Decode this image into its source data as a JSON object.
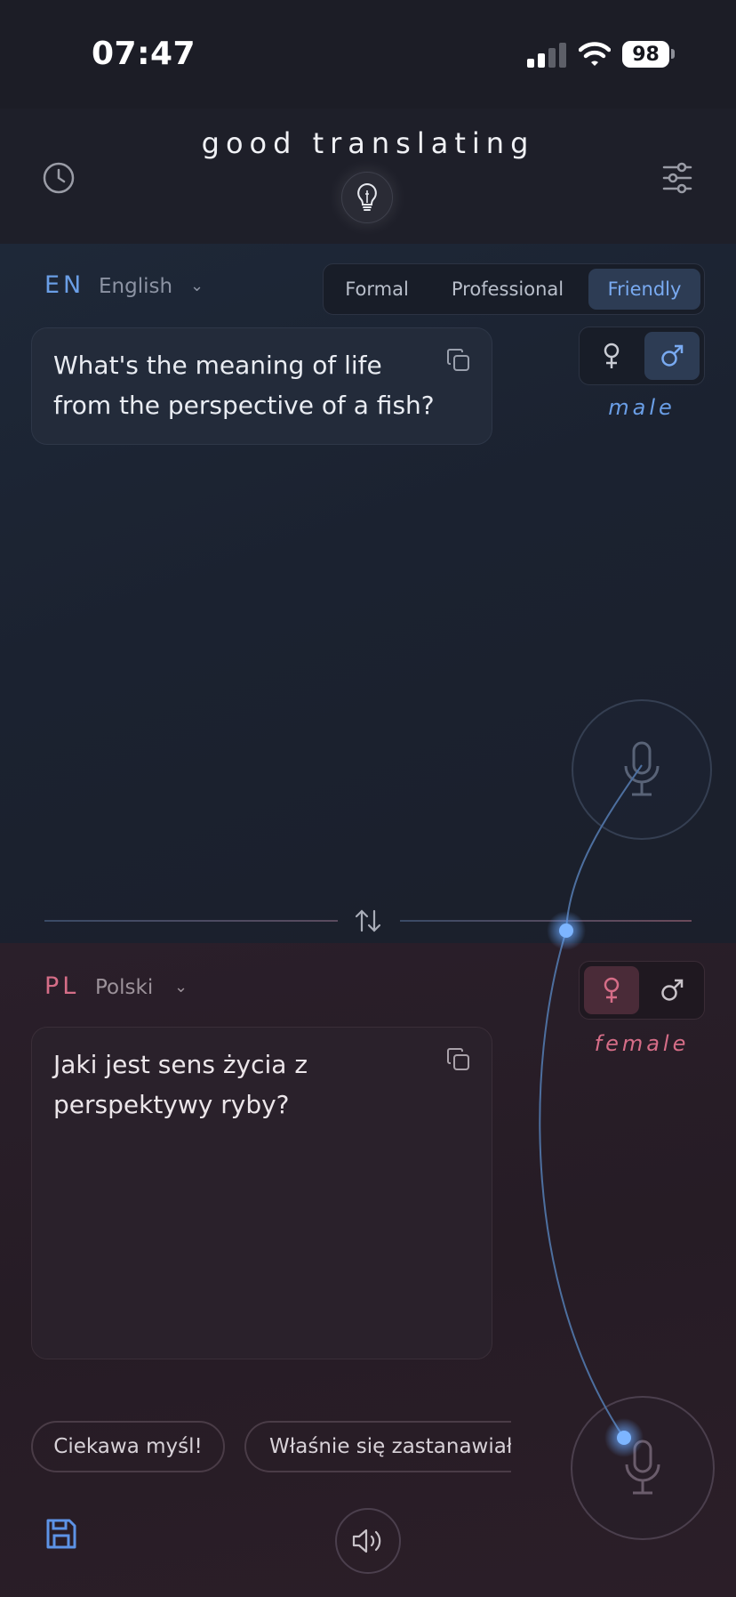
{
  "status_bar": {
    "time": "07:47",
    "battery": "98",
    "icons": [
      "signal-icon",
      "wifi-icon",
      "battery-icon"
    ]
  },
  "header": {
    "title": "good translating",
    "icons": [
      "history-clock-icon",
      "lightbulb-icon",
      "sliders-icon"
    ]
  },
  "source": {
    "code": "EN",
    "language": "English",
    "caret": "⌄",
    "tones": [
      "Formal",
      "Professional",
      "Friendly"
    ],
    "selected_tone": "Friendly",
    "gender_label": "male",
    "selected_gender": "male",
    "text": "What's the meaning of life from the perspective of a fish?",
    "accent_color": "#6a9ee6"
  },
  "target": {
    "code": "PL",
    "language": "Polski",
    "caret": "⌄",
    "gender_label": "female",
    "selected_gender": "female",
    "text": "Jaki jest sens życia z perspektywy ryby?",
    "suggestions": [
      "Ciekawa myśl!",
      "Właśnie się zastanawiałem"
    ],
    "accent_color": "#d56d87"
  }
}
